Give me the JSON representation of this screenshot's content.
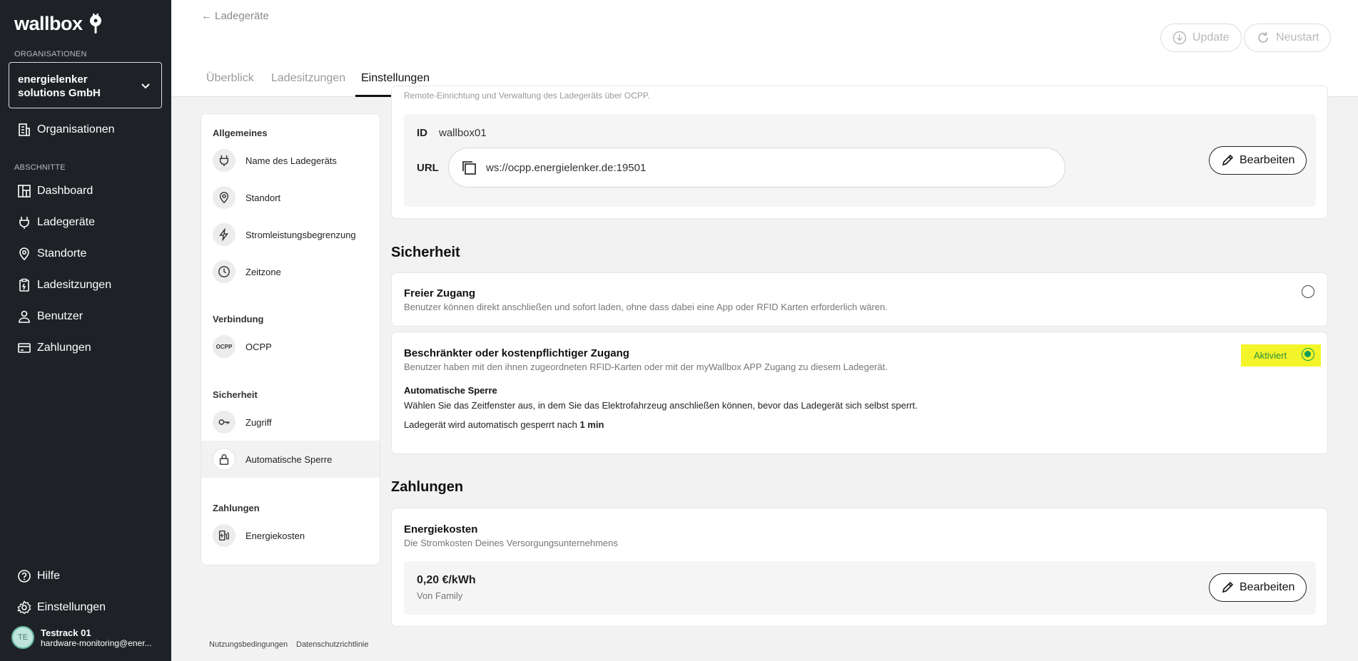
{
  "brand": {
    "name": "wallbox",
    "accent": "#0f9d58",
    "highlight": "#f4f42a"
  },
  "sidebar": {
    "org_section_label": "ORGANISATIONEN",
    "org_name": "energielenker solutions GmbH",
    "organisations_label": "Organisationen",
    "sections_label": "ABSCHNITTE",
    "items": [
      {
        "label": "Dashboard",
        "icon": "dashboard-icon"
      },
      {
        "label": "Ladegeräte",
        "icon": "plug-icon"
      },
      {
        "label": "Standorte",
        "icon": "location-icon"
      },
      {
        "label": "Ladesitzungen",
        "icon": "clipboard-icon"
      },
      {
        "label": "Benutzer",
        "icon": "user-icon"
      },
      {
        "label": "Zahlungen",
        "icon": "card-icon"
      }
    ],
    "help_label": "Hilfe",
    "settings_label": "Einstellungen",
    "user": {
      "initials": "TE",
      "name": "Testrack 01",
      "email": "hardware-monitoring@ener..."
    }
  },
  "header": {
    "back_label": "Ladegeräte",
    "update_label": "Update",
    "restart_label": "Neustart",
    "tabs": [
      {
        "label": "Überblick"
      },
      {
        "label": "Ladesitzungen"
      },
      {
        "label": "Einstellungen"
      }
    ]
  },
  "settings_nav": {
    "groups": [
      {
        "label": "Allgemeines"
      },
      {
        "label": "Verbindung"
      },
      {
        "label": "Sicherheit"
      },
      {
        "label": "Zahlungen"
      }
    ],
    "items": [
      {
        "label": "Name des Ladegeräts",
        "icon": "plug-icon"
      },
      {
        "label": "Standort",
        "icon": "location-icon"
      },
      {
        "label": "Stromleistungsbegrenzung",
        "icon": "bolt-icon"
      },
      {
        "label": "Zeitzone",
        "icon": "clock-icon"
      },
      {
        "label": "OCPP",
        "icon": "ocpp-icon",
        "icon_text": "OCPP"
      },
      {
        "label": "Zugriff",
        "icon": "key-icon"
      },
      {
        "label": "Automatische Sperre",
        "icon": "lock-icon"
      },
      {
        "label": "Energiekosten",
        "icon": "charger-icon"
      }
    ]
  },
  "ocpp": {
    "partial_text": "Remote-Einrichtung und Verwaltung des Ladegeräts über OCPP.",
    "id_label": "ID",
    "id_value": "wallbox01",
    "url_label": "URL",
    "url_value": "ws://ocpp.energielenker.de:19501",
    "edit_label": "Bearbeiten"
  },
  "security": {
    "title": "Sicherheit",
    "free": {
      "title": "Freier Zugang",
      "desc": "Benutzer können direkt anschließen und sofort laden, ohne dass dabei eine App oder RFID Karten erforderlich wären."
    },
    "restricted": {
      "title": "Beschränkter oder kostenpflichtiger Zugang",
      "desc": "Benutzer haben mit den ihnen zugeordneten RFID-Karten oder mit der myWallbox APP Zugang zu diesem Ladegerät.",
      "status": "Aktiviert",
      "auto_lock_title": "Automatische Sperre",
      "auto_lock_desc": "Wählen Sie das Zeitfenster aus, in dem Sie das Elektrofahrzeug anschließen können, bevor das Ladegerät sich selbst sperrt.",
      "auto_lock_prefix": "Ladegerät wird automatisch gesperrt nach",
      "auto_lock_value": "1 min"
    }
  },
  "payments": {
    "title": "Zahlungen",
    "energy_title": "Energiekosten",
    "energy_desc": "Die Stromkosten Deines Versorgungsunternehmens",
    "price": "0,20 €/kWh",
    "source": "Von Family",
    "edit_label": "Bearbeiten"
  },
  "footer": {
    "terms": "Nutzungsbedingungen",
    "privacy": "Datenschutzrichtlinie"
  }
}
